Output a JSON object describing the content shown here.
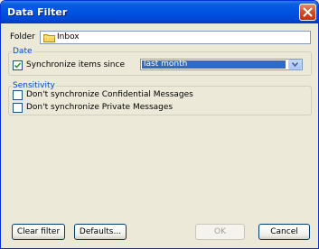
{
  "window": {
    "title": "Data Filter",
    "close_icon": "close-icon"
  },
  "folder": {
    "label": "Folder",
    "value": "Inbox",
    "icon": "folder-icon"
  },
  "date_group": {
    "title": "Date",
    "sync_label": "Synchronize items since",
    "sync_checked": true,
    "since_value": "last month"
  },
  "sensitivity_group": {
    "title": "Sensitivity",
    "confidential_label": "Don't synchronize Confidential Messages",
    "confidential_checked": false,
    "private_label": "Don't synchronize Private Messages",
    "private_checked": false
  },
  "buttons": {
    "clear_filter": "Clear filter",
    "defaults": "Defaults...",
    "ok": "OK",
    "cancel": "Cancel"
  },
  "colors": {
    "titlebar": "#0054e3",
    "group_title": "#0046d5",
    "selection": "#316ac5",
    "dialog_bg": "#ece9d8"
  }
}
